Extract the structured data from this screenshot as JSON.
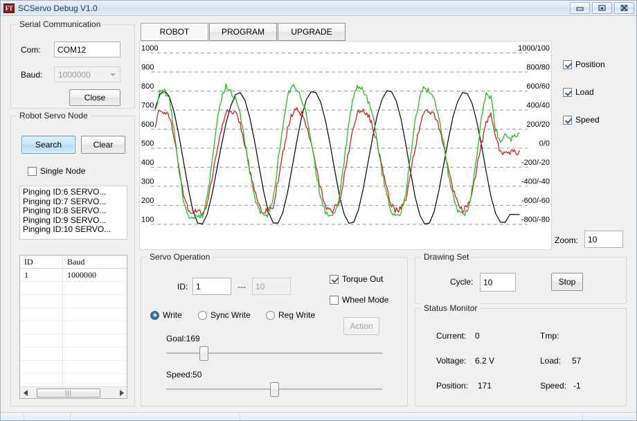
{
  "window": {
    "title": "SCServo Debug V1.0",
    "icon": "FT",
    "buttons": {
      "minimize": "minimize-icon",
      "maximize": "maximize-icon",
      "close": "close-icon"
    }
  },
  "serial": {
    "legend": "Serial Communication",
    "com_label": "Com:",
    "com_value": "COM12",
    "baud_label": "Baud:",
    "baud_value": "1000000",
    "close_button": "Close"
  },
  "node": {
    "legend": "Robot Servo Node",
    "search_button": "Search",
    "clear_button": "Clear",
    "single_node_label": "Single Node",
    "single_node_checked": false,
    "log": [
      "Pinging ID:6 SERVO...",
      "Pinging ID:7 SERVO...",
      "Pinging ID:8 SERVO...",
      "Pinging ID:9 SERVO...",
      "Pinging ID:10 SERVO..."
    ],
    "table": {
      "columns": [
        "ID",
        "Baud"
      ],
      "rows": [
        [
          "1",
          "1000000"
        ]
      ],
      "empty_rows": 9
    }
  },
  "tabs": [
    {
      "label": "ROBOT",
      "active": true
    },
    {
      "label": "PROGRAM",
      "active": false
    },
    {
      "label": "UPGRADE",
      "active": false
    }
  ],
  "chart_controls": {
    "checkboxes": [
      {
        "label": "Position",
        "checked": true,
        "color": "#000000"
      },
      {
        "label": "Load",
        "checked": true,
        "color": "#cc2222"
      },
      {
        "label": "Speed",
        "checked": true,
        "color": "#22bb22"
      }
    ],
    "zoom_label": "Zoom:",
    "zoom_value": "10"
  },
  "servo_operation": {
    "legend": "Servo Operation",
    "id_label": "ID:",
    "id_value": "1",
    "id_separator": "---",
    "id_end_value": "10",
    "torque_out_label": "Torque Out",
    "torque_out_checked": true,
    "wheel_mode_label": "Wheel Mode",
    "wheel_mode_checked": false,
    "modes": [
      {
        "label": "Write",
        "selected": true
      },
      {
        "label": "Sync Write",
        "selected": false
      },
      {
        "label": "Reg Write",
        "selected": false
      }
    ],
    "action_button": "Action",
    "goal_label": "Goal:169",
    "goal_percent": 16,
    "speed_label": "Speed:50",
    "speed_percent": 50
  },
  "drawing_set": {
    "legend": "Drawing Set",
    "cycle_label": "Cycle:",
    "cycle_value": "10",
    "stop_button": "Stop"
  },
  "status_monitor": {
    "legend": "Status Monitor",
    "items": [
      {
        "label": "Current:",
        "value": "0"
      },
      {
        "label": "Tmp:",
        "value": ""
      },
      {
        "label": "Voltage:",
        "value": "6.2 V"
      },
      {
        "label": "Load:",
        "value": "57"
      },
      {
        "label": "Position:",
        "value": "171"
      },
      {
        "label": "Speed:",
        "value": "-1"
      }
    ]
  },
  "chart_data": {
    "type": "line",
    "title": "",
    "xlabel": "",
    "ylabel": "",
    "grid": true,
    "legend_position": "right-external",
    "y_axis_left": {
      "ticks": [
        1000,
        900,
        800,
        700,
        600,
        500,
        400,
        300,
        200,
        100
      ],
      "ylim": [
        55,
        1040
      ]
    },
    "y_axis_right": {
      "ticks": [
        "1000/100",
        "800/80",
        "600/60",
        "400/40",
        "200/20",
        "0/0",
        "-200/-20",
        "-400/-40",
        "-600/-60",
        "-800/-80"
      ],
      "ylim": [
        -900,
        1100
      ]
    },
    "series": [
      {
        "name": "Position",
        "color": "#000000",
        "axis": "left",
        "description": "smooth sinusoidal sweep, 6.5 cycles, range 100-800",
        "values": [
          707,
          780,
          800,
          770,
          690,
          570,
          430,
          290,
          170,
          105,
          100,
          150,
          250,
          380,
          510,
          630,
          720,
          780,
          790,
          750,
          660,
          540,
          400,
          265,
          160,
          105,
          105,
          160,
          265,
          400,
          540,
          665,
          755,
          795,
          790,
          740,
          645,
          520,
          380,
          245,
          150,
          103,
          110,
          175,
          285,
          420,
          555,
          675,
          755,
          800,
          795,
          745,
          650,
          520,
          375,
          240,
          145,
          100,
          105,
          165,
          275,
          410,
          545,
          665,
          745,
          790,
          785,
          735,
          640,
          515,
          375,
          245,
          155,
          110,
          108,
          150,
          150,
          150
        ]
      },
      {
        "name": "Load",
        "color": "#cc2222",
        "axis": "right",
        "description": "noisy square-ish wave alternating roughly between +450 and -550",
        "values": [
          620,
          700,
          690,
          660,
          560,
          400,
          250,
          170,
          155,
          170,
          160,
          200,
          330,
          480,
          600,
          690,
          700,
          680,
          620,
          520,
          390,
          280,
          195,
          165,
          175,
          200,
          330,
          470,
          600,
          680,
          700,
          680,
          620,
          520,
          400,
          285,
          200,
          165,
          180,
          215,
          350,
          490,
          610,
          690,
          700,
          675,
          615,
          515,
          390,
          280,
          200,
          170,
          180,
          230,
          370,
          500,
          620,
          690,
          700,
          670,
          610,
          505,
          385,
          275,
          200,
          168,
          185,
          250,
          390,
          520,
          630,
          690,
          560,
          470,
          470,
          480,
          475,
          480
        ]
      },
      {
        "name": "Speed",
        "color": "#22bb22",
        "axis": "right",
        "description": "noisy square wave with higher amplitude, alternating roughly between +620 and -650",
        "values": [
          700,
          790,
          800,
          750,
          600,
          400,
          230,
          150,
          130,
          150,
          140,
          230,
          420,
          610,
          760,
          820,
          800,
          760,
          680,
          540,
          380,
          250,
          165,
          135,
          155,
          230,
          430,
          620,
          770,
          825,
          800,
          755,
          675,
          535,
          375,
          245,
          165,
          140,
          160,
          245,
          440,
          630,
          775,
          825,
          795,
          750,
          670,
          530,
          370,
          250,
          170,
          140,
          165,
          260,
          450,
          640,
          780,
          820,
          790,
          745,
          665,
          525,
          365,
          245,
          168,
          145,
          175,
          275,
          460,
          650,
          785,
          760,
          600,
          520,
          560,
          540,
          555,
          575
        ]
      }
    ]
  }
}
